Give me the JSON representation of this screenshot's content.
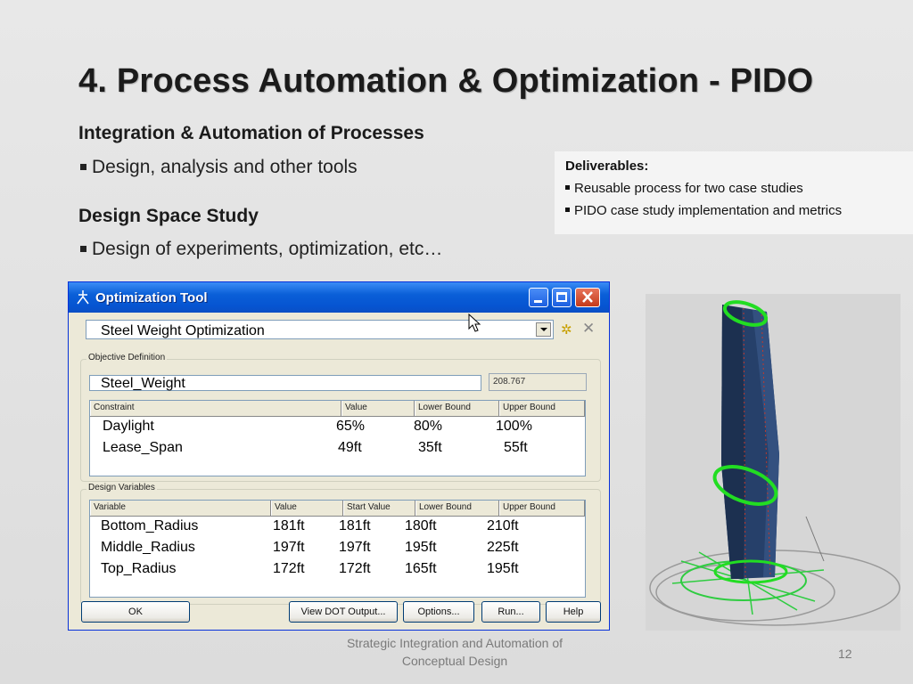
{
  "slide": {
    "title": "4. Process Automation & Optimization - PIDO",
    "section1": {
      "heading": "Integration & Automation of Processes",
      "bullet": "Design, analysis and other tools"
    },
    "section2": {
      "heading": "Design Space Study",
      "bullet": "Design of experiments, optimization, etc…"
    },
    "deliverables": {
      "heading": "Deliverables:",
      "items": [
        "Reusable process for two case studies",
        "PIDO case study implementation and metrics"
      ]
    },
    "footer": "Strategic Integration and Automation of Conceptual Design",
    "page_number": "12"
  },
  "window": {
    "title": "Optimization Tool",
    "selected_study": "Steel Weight Optimization",
    "objective": {
      "group_label": "Objective Definition",
      "name": "Steel_Weight",
      "value": "208.767"
    },
    "constraints": {
      "headers": [
        "Constraint",
        "Value",
        "Lower Bound",
        "Upper Bound"
      ],
      "rows": [
        {
          "name": "Daylight",
          "value": "65%",
          "lower": "80%",
          "upper": "100%"
        },
        {
          "name": "Lease_Span",
          "value": "49ft",
          "lower": "35ft",
          "upper": "55ft"
        }
      ]
    },
    "design_variables": {
      "group_label": "Design Variables",
      "headers": [
        "Variable",
        "Value",
        "Start Value",
        "Lower Bound",
        "Upper Bound"
      ],
      "rows": [
        {
          "name": "Bottom_Radius",
          "value": "181ft",
          "start": "181ft",
          "lower": "180ft",
          "upper": "210ft"
        },
        {
          "name": "Middle_Radius",
          "value": "197ft",
          "start": "197ft",
          "lower": "195ft",
          "upper": "225ft"
        },
        {
          "name": "Top_Radius",
          "value": "172ft",
          "start": "172ft",
          "lower": "165ft",
          "upper": "195ft"
        }
      ]
    },
    "buttons": {
      "ok": "OK",
      "view_dot": "View DOT Output...",
      "options": "Options...",
      "run": "Run...",
      "help": "Help"
    }
  },
  "colors": {
    "titlebar": "#0a5fd8",
    "dialog_bg": "#ece9d8",
    "tower": "#243a5e",
    "highlight_ring": "#22dd22"
  }
}
